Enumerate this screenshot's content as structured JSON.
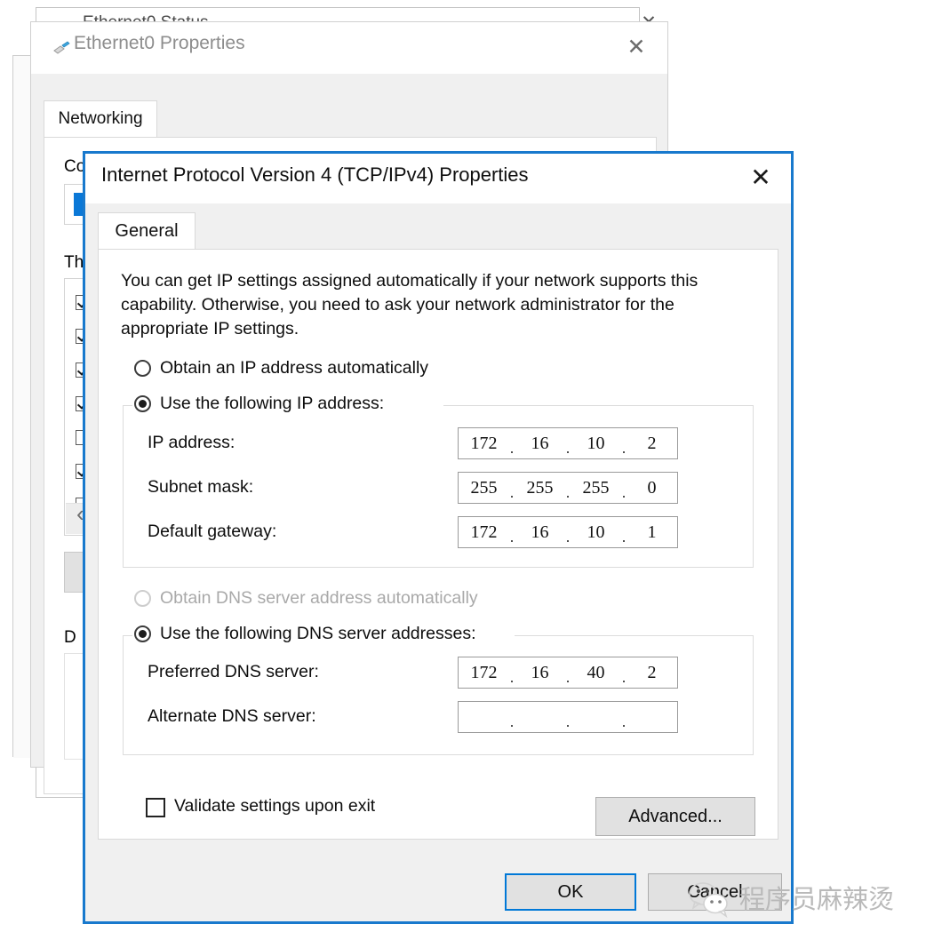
{
  "background": {
    "status_window": {
      "title": "Ethernet0 Status",
      "close_label": "✕"
    },
    "properties_window": {
      "title": "Ethernet0 Properties",
      "close_label": "✕",
      "icon": "network-adapter-icon",
      "tab_label": "Networking",
      "connect_using_label": "Connect using:",
      "this_connection_label": "Th",
      "description_label": "D",
      "items_checked": [
        true,
        true,
        true,
        true,
        false,
        true,
        true
      ],
      "scroll_left_glyph": "‹"
    }
  },
  "dialog": {
    "title": "Internet Protocol Version 4 (TCP/IPv4) Properties",
    "close_label": "✕",
    "tab_label": "General",
    "description": "You can get IP settings assigned automatically if your network supports this capability. Otherwise, you need to ask your network administrator for the appropriate IP settings.",
    "ip_mode": {
      "auto_label": "Obtain an IP address automatically",
      "auto_selected": false,
      "manual_label": "Use the following IP address:",
      "manual_selected": true
    },
    "ip_fields": [
      {
        "label": "IP address:",
        "octets": [
          "172",
          "16",
          "10",
          "2"
        ]
      },
      {
        "label": "Subnet mask:",
        "octets": [
          "255",
          "255",
          "255",
          "0"
        ]
      },
      {
        "label": "Default gateway:",
        "octets": [
          "172",
          "16",
          "10",
          "1"
        ]
      }
    ],
    "dns_mode": {
      "auto_label": "Obtain DNS server address automatically",
      "auto_selected": false,
      "auto_disabled": true,
      "manual_label": "Use the following DNS server addresses:",
      "manual_selected": true
    },
    "dns_fields": [
      {
        "label": "Preferred DNS server:",
        "octets": [
          "172",
          "16",
          "40",
          "2"
        ]
      },
      {
        "label": "Alternate DNS server:",
        "octets": [
          "",
          "",
          "",
          ""
        ]
      }
    ],
    "validate": {
      "label": "Validate settings upon exit",
      "checked": false
    },
    "buttons": {
      "advanced": "Advanced...",
      "ok": "OK",
      "cancel": "Cancel",
      "ok_focused": true
    },
    "accent_color": "#0078d7",
    "border_color": "#1879cd"
  },
  "watermark": {
    "text": "程序员麻辣烫",
    "logo": "wechat-logo"
  }
}
